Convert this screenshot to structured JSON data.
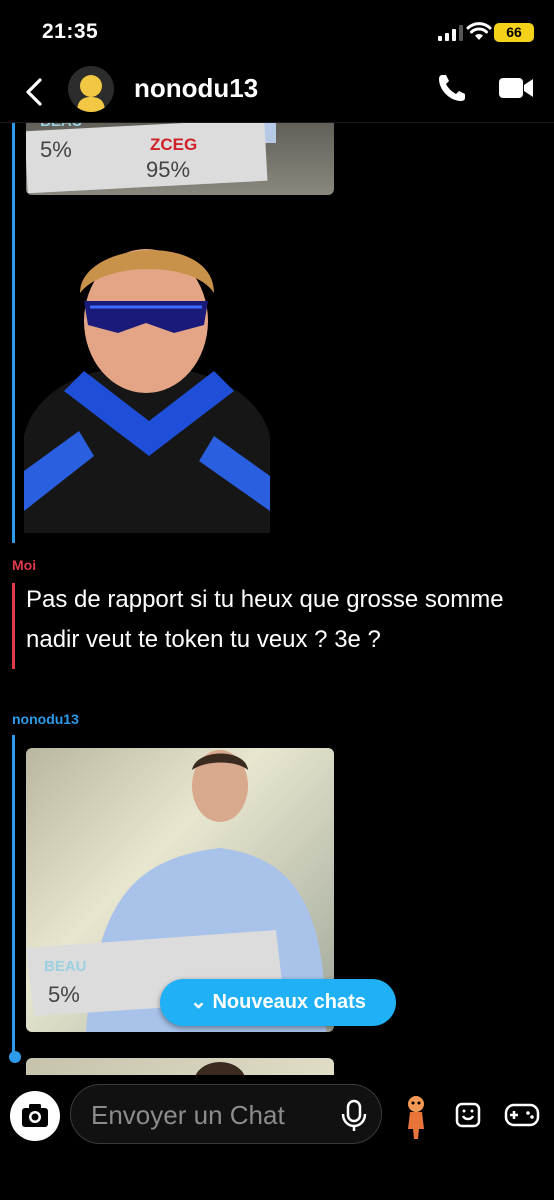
{
  "status_bar": {
    "time": "21:35",
    "battery": "66"
  },
  "header": {
    "username": "nonodu13"
  },
  "messages": [
    {
      "sender": "Moi",
      "text": "Pas de rapport si tu heux que grosse somme nadir veut te token tu veux ? 3e ?"
    },
    {
      "sender": "nonodu13"
    }
  ],
  "photo_labels": {
    "left_tag": "BEAU",
    "left_pct": "5%",
    "right_tag": "ZCEG",
    "right_pct": "95%"
  },
  "new_chats_label": "Nouveaux chats",
  "composer": {
    "placeholder": "Envoyer un Chat"
  },
  "colors": {
    "accent_blue": "#2e9bea",
    "accent_red": "#e0394a",
    "pill_blue": "#1fb0f5"
  }
}
